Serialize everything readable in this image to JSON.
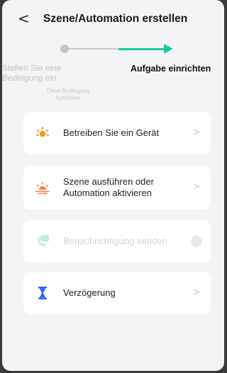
{
  "header": {
    "back_glyph": "<",
    "title": "Szene/Automation erstellen"
  },
  "stepper": {
    "step1_label": "Stellen Sie eine Bedingung ein",
    "step1_sub": "Ohne Bedingung fortfahren",
    "step2_label": "Aufgabe einrichten"
  },
  "actions": [
    {
      "label": "Betreiben Sie ein Gerät",
      "icon": "sun-device-icon",
      "enabled": true
    },
    {
      "label": "Szene ausführen oder Automation aktivieren",
      "icon": "sunset-scene-icon",
      "enabled": true
    },
    {
      "label": "Benachrichtigung senden",
      "icon": "notification-icon",
      "enabled": false
    },
    {
      "label": "Verzögerung",
      "icon": "hourglass-icon",
      "enabled": true
    }
  ],
  "chevron": ">",
  "colors": {
    "accent": "#18c9a2",
    "orange": "#ff9a1f",
    "blue": "#2a64f6",
    "disabled_icon": "#bfeee3"
  }
}
